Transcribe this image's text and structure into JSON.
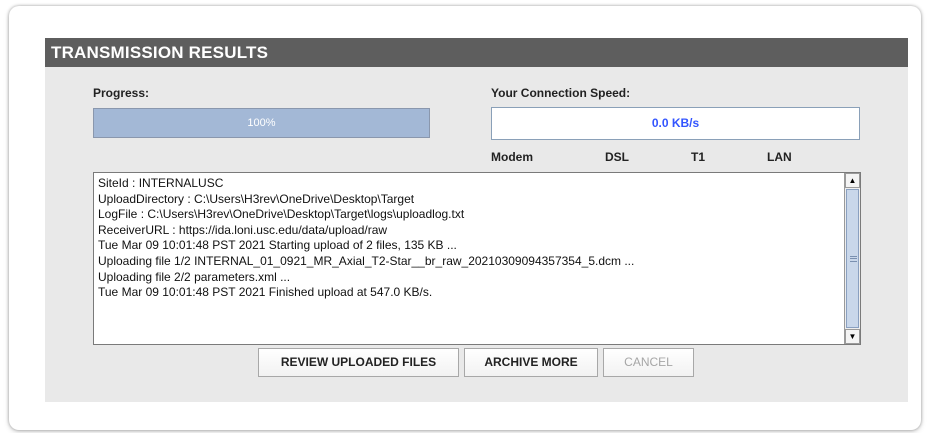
{
  "panel": {
    "title": "TRANSMISSION RESULTS"
  },
  "progress": {
    "label": "Progress:",
    "value_text": "100%",
    "value": 1.0
  },
  "speed": {
    "label": "Your Connection Speed:",
    "value_text": "0.0 KB/s",
    "ticks": [
      "Modem",
      "DSL",
      "T1",
      "LAN"
    ]
  },
  "log": {
    "lines": [
      "SiteId : INTERNALUSC",
      "UploadDirectory : C:\\Users\\H3rev\\OneDrive\\Desktop\\Target",
      "LogFile : C:\\Users\\H3rev\\OneDrive\\Desktop\\Target\\logs\\uploadlog.txt",
      "ReceiverURL : https://ida.loni.usc.edu/data/upload/raw",
      "Tue Mar 09 10:01:48 PST 2021 Starting upload of 2 files, 135 KB ...",
      "Uploading file 1/2 INTERNAL_01_0921_MR_Axial_T2-Star__br_raw_20210309094357354_5.dcm ...",
      "Uploading file 2/2 parameters.xml ...",
      "Tue Mar 09 10:01:48 PST 2021 Finished upload at 547.0 KB/s."
    ]
  },
  "buttons": {
    "review": "REVIEW UPLOADED FILES",
    "archive": "ARCHIVE MORE",
    "cancel": "CANCEL"
  },
  "colors": {
    "header_bg": "#5e5e5e",
    "progress_fill": "#a3b8d6",
    "speed_text": "#3355ff"
  }
}
